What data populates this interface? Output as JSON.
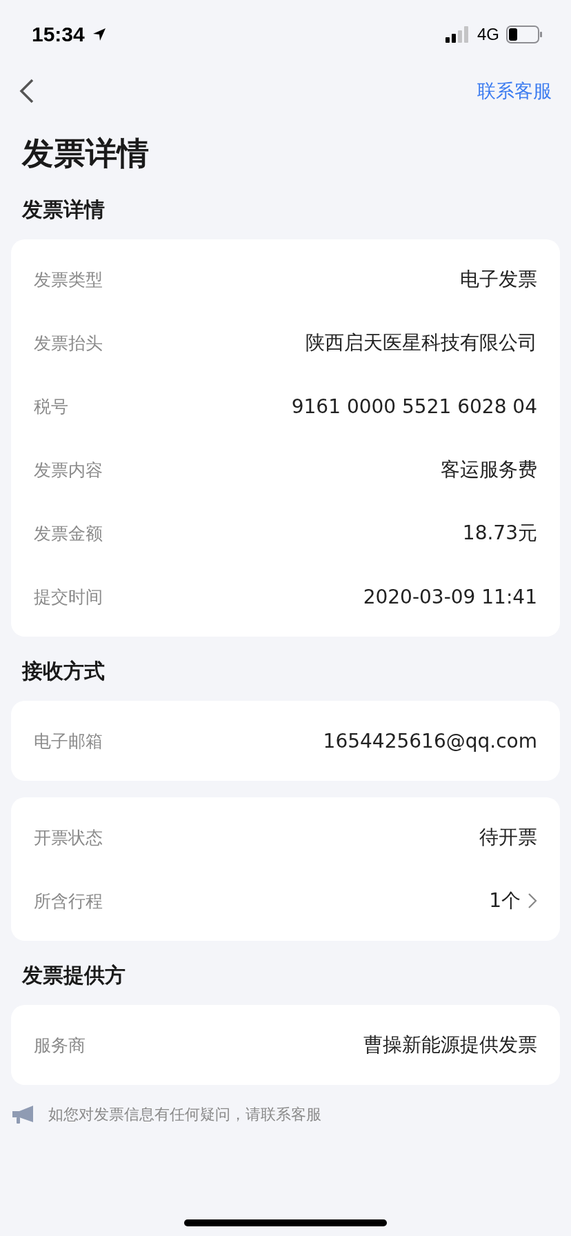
{
  "status_bar": {
    "time": "15:34",
    "network": "4G",
    "battery": {
      "level": 0.3
    }
  },
  "nav": {
    "action": "联系客服"
  },
  "title": "发票详情",
  "sections": [
    {
      "heading": "发票详情",
      "rows": [
        {
          "label": "发票类型",
          "value": "电子发票",
          "kind": "plain"
        },
        {
          "label": "发票抬头",
          "value": "陕西启天医星科技有限公司",
          "kind": "plain"
        },
        {
          "label": "税号",
          "value": "9161 0000 5521 6028 04",
          "kind": "plain"
        },
        {
          "label": "发票内容",
          "value": "客运服务费",
          "kind": "plain"
        },
        {
          "label": "发票金额",
          "value": "18.73元",
          "kind": "plain"
        },
        {
          "label": "提交时间",
          "value": "2020-03-09 11:41",
          "kind": "plain"
        }
      ]
    },
    {
      "heading": "接收方式",
      "rows": [
        {
          "label": "电子邮箱",
          "value": "1654425616@qq.com",
          "kind": "plain"
        }
      ]
    },
    {
      "rows": [
        {
          "label": "开票状态",
          "value": "待开票",
          "kind": "plain"
        },
        {
          "label": "所含行程",
          "value": "1个",
          "kind": "link"
        }
      ]
    },
    {
      "heading": "发票提供方",
      "rows": [
        {
          "label": "服务商",
          "value": "曹操新能源提供发票",
          "kind": "plain"
        }
      ]
    }
  ],
  "notice": "如您对发票信息有任何疑问，请联系客服"
}
